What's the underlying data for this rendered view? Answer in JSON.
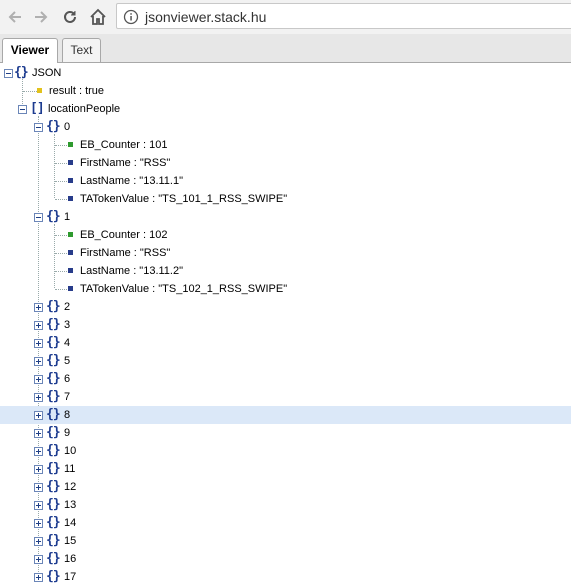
{
  "browser": {
    "url": "jsonviewer.stack.hu"
  },
  "tabs": [
    {
      "label": "Viewer",
      "active": true
    },
    {
      "label": "Text",
      "active": false
    }
  ],
  "colors": {
    "brace": "#1c3b8f",
    "number_square": "#2e9a2e",
    "string_square": "#283c8a",
    "bool_square": "#e2c21c",
    "selected_row": "#dbe8f8"
  },
  "tree": {
    "root_label": "JSON",
    "result_label": "result : true",
    "array_label": "locationPeople",
    "item0": {
      "label": "0",
      "eb_counter": "EB_Counter : 101",
      "first_name": "FirstName : \"RSS\"",
      "last_name": "LastName : \"13.11.1\"",
      "token": "TATokenValue : \"TS_101_1_RSS_SWIPE\""
    },
    "item1": {
      "label": "1",
      "eb_counter": "EB_Counter : 102",
      "first_name": "FirstName : \"RSS\"",
      "last_name": "LastName : \"13.11.2\"",
      "token": "TATokenValue : \"TS_102_1_RSS_SWIPE\""
    },
    "collapsed_items": [
      "2",
      "3",
      "4",
      "5",
      "6",
      "7",
      "8",
      "9",
      "10",
      "11",
      "12",
      "13",
      "14",
      "15",
      "16",
      "17"
    ],
    "selected_item": "8"
  }
}
